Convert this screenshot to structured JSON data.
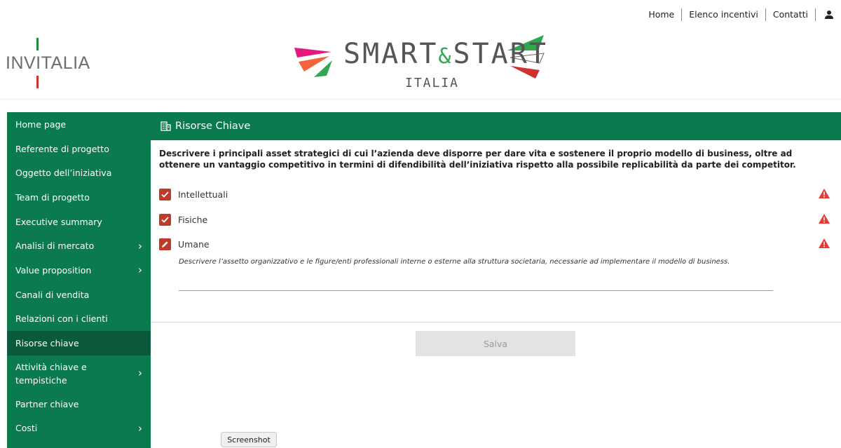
{
  "topnav": {
    "home": "Home",
    "incentivi": "Elenco incentivi",
    "contatti": "Contatti",
    "user_icon": "user-icon"
  },
  "logos": {
    "invitalia": "INVITALIA",
    "smart_title_a": "SMART",
    "smart_amp": "&",
    "smart_title_b": "START",
    "smart_sub": "ITALIA"
  },
  "sidebar": {
    "items": [
      {
        "label": "Home page",
        "chevron": ""
      },
      {
        "label": "Referente di progetto",
        "chevron": ""
      },
      {
        "label": "Oggetto dell’iniziativa",
        "chevron": ""
      },
      {
        "label": "Team di progetto",
        "chevron": ""
      },
      {
        "label": "Executive summary",
        "chevron": ""
      },
      {
        "label": "Analisi di mercato",
        "chevron": "›"
      },
      {
        "label": "Value proposition",
        "chevron": "›"
      },
      {
        "label": "Canali di vendita",
        "chevron": ""
      },
      {
        "label": "Relazioni con i clienti",
        "chevron": ""
      },
      {
        "label": "Risorse chiave",
        "chevron": ""
      },
      {
        "label": "Attività chiave e tempistiche",
        "chevron": "›"
      },
      {
        "label": "Partner chiave",
        "chevron": ""
      },
      {
        "label": "Costi",
        "chevron": "›"
      }
    ],
    "active_index": 9
  },
  "panel": {
    "title": "Risorse Chiave",
    "title_icon": "building-icon",
    "description": "Descrivere i principali asset strategici di cui l’azienda deve disporre per dare vita e sostenere il proprio modello di business, oltre ad ottenere un vantaggio competitivo in termini di difendibilità dell’iniziativa rispetto alla possibile replicabilità da parte dei competitor.",
    "options": [
      {
        "label": "Intellettuali",
        "state": "checked"
      },
      {
        "label": "Fisiche",
        "state": "checked"
      },
      {
        "label": "Umane",
        "state": "editing"
      }
    ],
    "hint": "Descrivere l’assetto organizzativo e le figure/enti professionali interne o esterne alla struttura societaria, necessarie ad implementare il modello di business.",
    "textarea_value": "",
    "save_label": "Salva"
  },
  "screenshot_label": "Screenshot",
  "colors": {
    "brand_green": "#0b7a4f",
    "active_green": "#09593a",
    "checkbox_red": "#c0392b",
    "warning_red": "#e53935"
  }
}
